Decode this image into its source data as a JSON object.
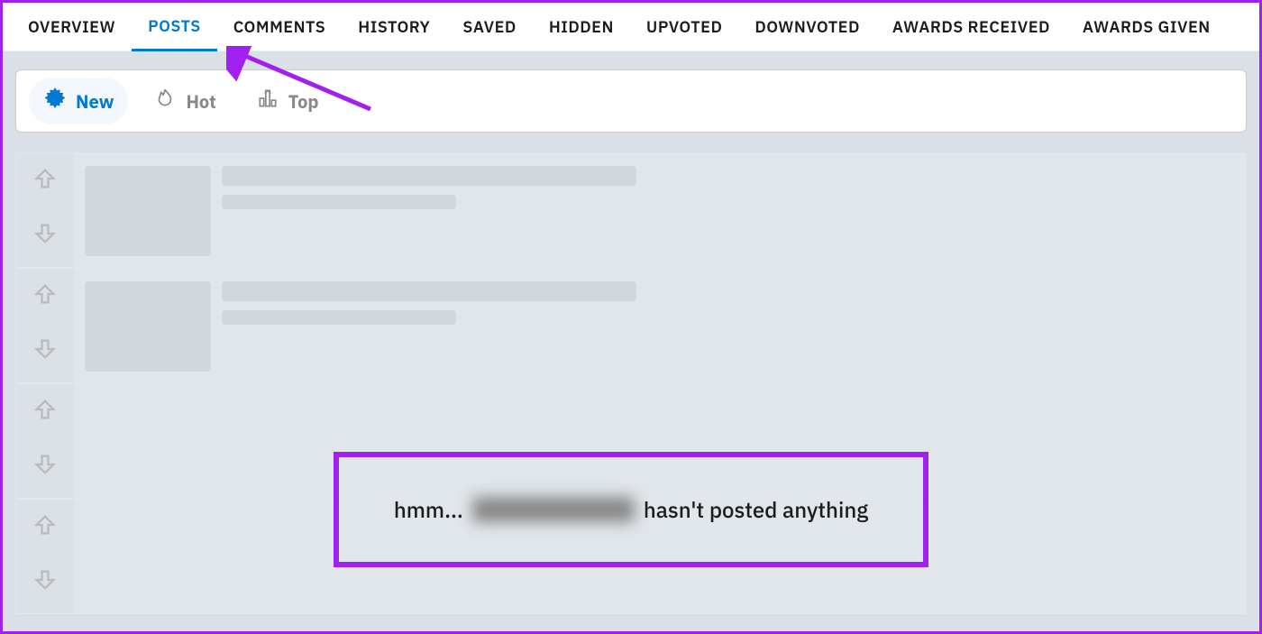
{
  "tabs": {
    "overview": "OVERVIEW",
    "posts": "POSTS",
    "comments": "COMMENTS",
    "history": "HISTORY",
    "saved": "SAVED",
    "hidden": "HIDDEN",
    "upvoted": "UPVOTED",
    "downvoted": "DOWNVOTED",
    "awards_received": "AWARDS RECEIVED",
    "awards_given": "AWARDS GIVEN"
  },
  "sort": {
    "new": "New",
    "hot": "Hot",
    "top": "Top"
  },
  "empty": {
    "prefix": "hmm...",
    "suffix": "hasn't posted anything"
  }
}
